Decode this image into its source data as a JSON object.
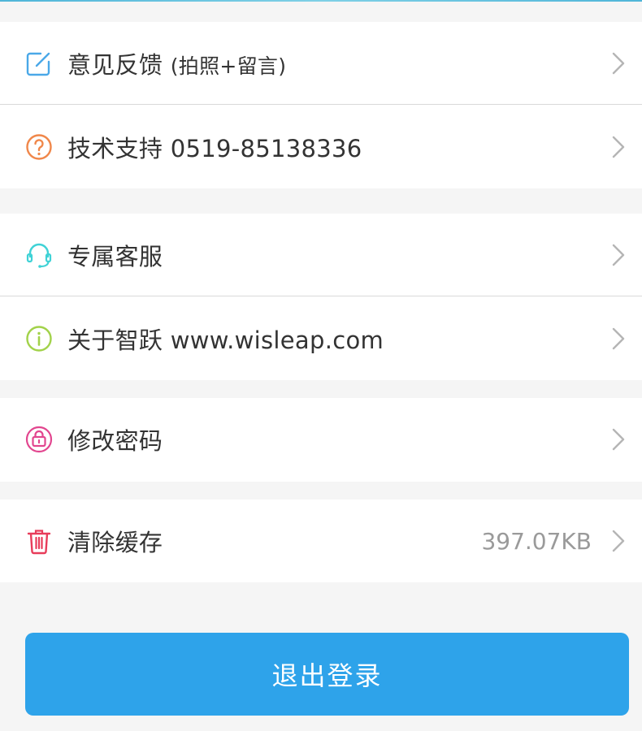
{
  "settings": {
    "feedback": {
      "label": "意见反馈",
      "hint": "(拍照+留言)",
      "icon": "edit-icon"
    },
    "support": {
      "label": "技术支持 0519-85138336",
      "icon": "question-circle-icon"
    },
    "service": {
      "label": "专属客服",
      "icon": "headset-icon"
    },
    "about": {
      "label": "关于智跃 www.wisleap.com",
      "icon": "info-circle-icon"
    },
    "password": {
      "label": "修改密码",
      "icon": "lock-icon"
    },
    "cache": {
      "label": "清除缓存",
      "value": "397.07KB",
      "icon": "trash-icon"
    }
  },
  "logout": {
    "label": "退出登录"
  },
  "colors": {
    "accent_blue": "#2ea3ea",
    "feedback_icon": "#4aa8e8",
    "support_icon": "#f0874a",
    "service_icon": "#3fd2d6",
    "about_icon": "#a2d24a",
    "password_icon": "#e2468f",
    "cache_icon": "#e83c5a"
  }
}
